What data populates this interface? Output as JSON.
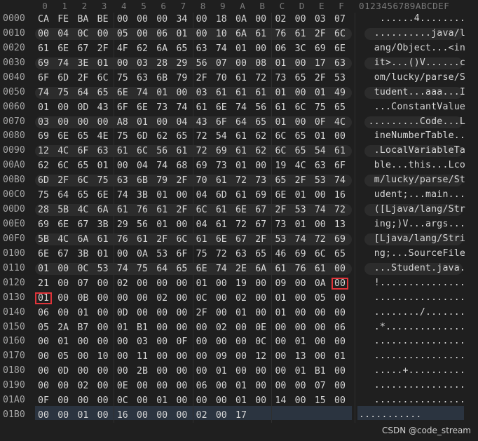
{
  "header": {
    "columns": [
      "0",
      "1",
      "2",
      "3",
      "4",
      "5",
      "6",
      "7",
      "8",
      "9",
      "A",
      "B",
      "C",
      "D",
      "E",
      "F"
    ],
    "ascii_header": "0123456789ABCDEF"
  },
  "rows": [
    {
      "offset": "0000",
      "hex": [
        "CA",
        "FE",
        "BA",
        "BE",
        "00",
        "00",
        "00",
        "34",
        "00",
        "18",
        "0A",
        "00",
        "02",
        "00",
        "03",
        "07"
      ],
      "ascii": "......4........"
    },
    {
      "offset": "0010",
      "hex": [
        "00",
        "04",
        "0C",
        "00",
        "05",
        "00",
        "06",
        "01",
        "00",
        "10",
        "6A",
        "61",
        "76",
        "61",
        "2F",
        "6C"
      ],
      "ascii": "..........java/l"
    },
    {
      "offset": "0020",
      "hex": [
        "61",
        "6E",
        "67",
        "2F",
        "4F",
        "62",
        "6A",
        "65",
        "63",
        "74",
        "01",
        "00",
        "06",
        "3C",
        "69",
        "6E"
      ],
      "ascii": "ang/Object...<in"
    },
    {
      "offset": "0030",
      "hex": [
        "69",
        "74",
        "3E",
        "01",
        "00",
        "03",
        "28",
        "29",
        "56",
        "07",
        "00",
        "08",
        "01",
        "00",
        "17",
        "63"
      ],
      "ascii": "it>...()V......c"
    },
    {
      "offset": "0040",
      "hex": [
        "6F",
        "6D",
        "2F",
        "6C",
        "75",
        "63",
        "6B",
        "79",
        "2F",
        "70",
        "61",
        "72",
        "73",
        "65",
        "2F",
        "53"
      ],
      "ascii": "om/lucky/parse/S"
    },
    {
      "offset": "0050",
      "hex": [
        "74",
        "75",
        "64",
        "65",
        "6E",
        "74",
        "01",
        "00",
        "03",
        "61",
        "61",
        "61",
        "01",
        "00",
        "01",
        "49"
      ],
      "ascii": "tudent...aaa...I"
    },
    {
      "offset": "0060",
      "hex": [
        "01",
        "00",
        "0D",
        "43",
        "6F",
        "6E",
        "73",
        "74",
        "61",
        "6E",
        "74",
        "56",
        "61",
        "6C",
        "75",
        "65"
      ],
      "ascii": "...ConstantValue"
    },
    {
      "offset": "0070",
      "hex": [
        "03",
        "00",
        "00",
        "00",
        "A8",
        "01",
        "00",
        "04",
        "43",
        "6F",
        "64",
        "65",
        "01",
        "00",
        "0F",
        "4C"
      ],
      "ascii": ".........Code...L"
    },
    {
      "offset": "0080",
      "hex": [
        "69",
        "6E",
        "65",
        "4E",
        "75",
        "6D",
        "62",
        "65",
        "72",
        "54",
        "61",
        "62",
        "6C",
        "65",
        "01",
        "00"
      ],
      "ascii": "ineNumberTable.."
    },
    {
      "offset": "0090",
      "hex": [
        "12",
        "4C",
        "6F",
        "63",
        "61",
        "6C",
        "56",
        "61",
        "72",
        "69",
        "61",
        "62",
        "6C",
        "65",
        "54",
        "61"
      ],
      "ascii": ".LocalVariableTa"
    },
    {
      "offset": "00A0",
      "hex": [
        "62",
        "6C",
        "65",
        "01",
        "00",
        "04",
        "74",
        "68",
        "69",
        "73",
        "01",
        "00",
        "19",
        "4C",
        "63",
        "6F"
      ],
      "ascii": "ble...this...Lco"
    },
    {
      "offset": "00B0",
      "hex": [
        "6D",
        "2F",
        "6C",
        "75",
        "63",
        "6B",
        "79",
        "2F",
        "70",
        "61",
        "72",
        "73",
        "65",
        "2F",
        "53",
        "74"
      ],
      "ascii": "m/lucky/parse/St"
    },
    {
      "offset": "00C0",
      "hex": [
        "75",
        "64",
        "65",
        "6E",
        "74",
        "3B",
        "01",
        "00",
        "04",
        "6D",
        "61",
        "69",
        "6E",
        "01",
        "00",
        "16"
      ],
      "ascii": "udent;...main..."
    },
    {
      "offset": "00D0",
      "hex": [
        "28",
        "5B",
        "4C",
        "6A",
        "61",
        "76",
        "61",
        "2F",
        "6C",
        "61",
        "6E",
        "67",
        "2F",
        "53",
        "74",
        "72"
      ],
      "ascii": "([Ljava/lang/Str"
    },
    {
      "offset": "00E0",
      "hex": [
        "69",
        "6E",
        "67",
        "3B",
        "29",
        "56",
        "01",
        "00",
        "04",
        "61",
        "72",
        "67",
        "73",
        "01",
        "00",
        "13"
      ],
      "ascii": "ing;)V...args..."
    },
    {
      "offset": "00F0",
      "hex": [
        "5B",
        "4C",
        "6A",
        "61",
        "76",
        "61",
        "2F",
        "6C",
        "61",
        "6E",
        "67",
        "2F",
        "53",
        "74",
        "72",
        "69"
      ],
      "ascii": "[Ljava/lang/Stri"
    },
    {
      "offset": "0100",
      "hex": [
        "6E",
        "67",
        "3B",
        "01",
        "00",
        "0A",
        "53",
        "6F",
        "75",
        "72",
        "63",
        "65",
        "46",
        "69",
        "6C",
        "65"
      ],
      "ascii": "ng;...SourceFile"
    },
    {
      "offset": "0110",
      "hex": [
        "01",
        "00",
        "0C",
        "53",
        "74",
        "75",
        "64",
        "65",
        "6E",
        "74",
        "2E",
        "6A",
        "61",
        "76",
        "61",
        "00"
      ],
      "ascii": "...Student.java."
    },
    {
      "offset": "0120",
      "hex": [
        "21",
        "00",
        "07",
        "00",
        "02",
        "00",
        "00",
        "00",
        "01",
        "00",
        "19",
        "00",
        "09",
        "00",
        "0A",
        "00"
      ],
      "ascii": "!..............."
    },
    {
      "offset": "0130",
      "hex": [
        "01",
        "00",
        "0B",
        "00",
        "00",
        "00",
        "02",
        "00",
        "0C",
        "00",
        "02",
        "00",
        "01",
        "00",
        "05",
        "00"
      ],
      "ascii": "................"
    },
    {
      "offset": "0140",
      "hex": [
        "06",
        "00",
        "01",
        "00",
        "0D",
        "00",
        "00",
        "00",
        "2F",
        "00",
        "01",
        "00",
        "01",
        "00",
        "00",
        "00"
      ],
      "ascii": "......../......."
    },
    {
      "offset": "0150",
      "hex": [
        "05",
        "2A",
        "B7",
        "00",
        "01",
        "B1",
        "00",
        "00",
        "00",
        "02",
        "00",
        "0E",
        "00",
        "00",
        "00",
        "06"
      ],
      "ascii": ".*.............."
    },
    {
      "offset": "0160",
      "hex": [
        "00",
        "01",
        "00",
        "00",
        "00",
        "03",
        "00",
        "0F",
        "00",
        "00",
        "00",
        "0C",
        "00",
        "01",
        "00",
        "00"
      ],
      "ascii": "................"
    },
    {
      "offset": "0170",
      "hex": [
        "00",
        "05",
        "00",
        "10",
        "00",
        "11",
        "00",
        "00",
        "00",
        "09",
        "00",
        "12",
        "00",
        "13",
        "00",
        "01"
      ],
      "ascii": "................"
    },
    {
      "offset": "0180",
      "hex": [
        "00",
        "0D",
        "00",
        "00",
        "00",
        "2B",
        "00",
        "00",
        "00",
        "01",
        "00",
        "00",
        "00",
        "01",
        "B1",
        "00"
      ],
      "ascii": ".....+.........."
    },
    {
      "offset": "0190",
      "hex": [
        "00",
        "00",
        "02",
        "00",
        "0E",
        "00",
        "00",
        "00",
        "06",
        "00",
        "01",
        "00",
        "00",
        "00",
        "07",
        "00"
      ],
      "ascii": "................"
    },
    {
      "offset": "01A0",
      "hex": [
        "0F",
        "00",
        "00",
        "00",
        "0C",
        "00",
        "01",
        "00",
        "00",
        "00",
        "01",
        "00",
        "14",
        "00",
        "15",
        "00"
      ],
      "ascii": "................"
    },
    {
      "offset": "01B0",
      "hex": [
        "00",
        "00",
        "01",
        "00",
        "16",
        "00",
        "00",
        "00",
        "02",
        "00",
        "17"
      ],
      "ascii": "..........."
    }
  ],
  "highlight": [
    {
      "row": 18,
      "col": 15
    },
    {
      "row": 19,
      "col": 0
    }
  ],
  "watermark": "CSDN @code_stream",
  "colors": {
    "background": "#1f1f1f",
    "highlight_border": "#e0343a",
    "selection": "#2b3440"
  }
}
